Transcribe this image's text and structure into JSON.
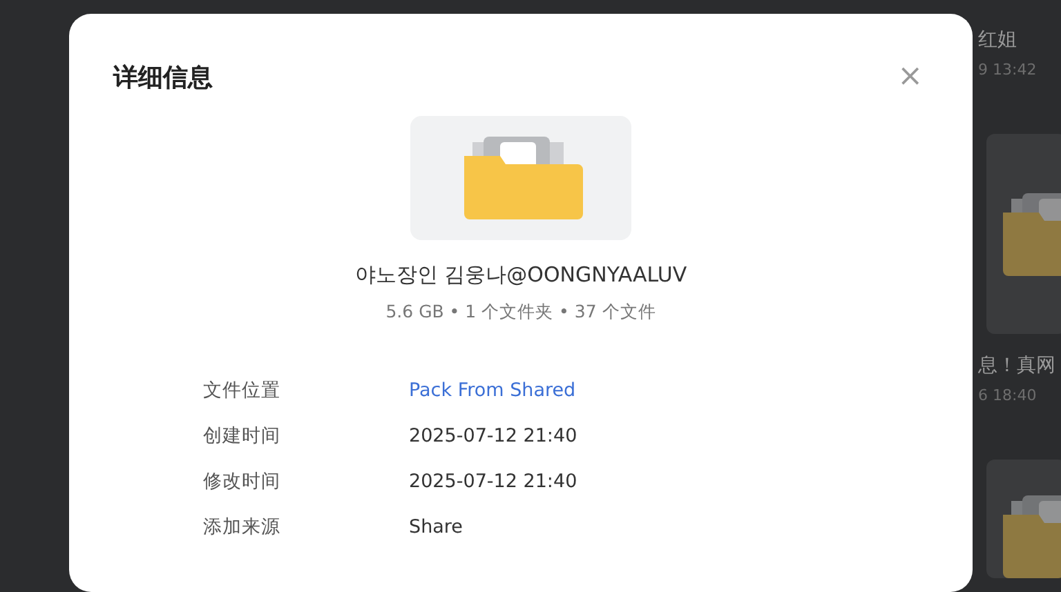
{
  "background_items": [
    {
      "kind": "text",
      "title": "红姐",
      "time": "9 13:42"
    },
    {
      "kind": "card"
    },
    {
      "kind": "text",
      "title": "息！真网",
      "time": "6 18:40"
    },
    {
      "kind": "card"
    }
  ],
  "dialog": {
    "title": "详细信息",
    "close": "×",
    "item": {
      "name": "야노장인 김웅나@OONGNYAALUV",
      "meta": "5.6 GB • 1 个文件夹 • 37 个文件"
    },
    "details": [
      {
        "label": "文件位置",
        "value": "Pack From Shared",
        "kind": "link"
      },
      {
        "label": "创建时间",
        "value": "2025-07-12 21:40",
        "kind": "text"
      },
      {
        "label": "修改时间",
        "value": "2025-07-12 21:40",
        "kind": "text"
      },
      {
        "label": "添加来源",
        "value": "Share",
        "kind": "text"
      }
    ]
  }
}
